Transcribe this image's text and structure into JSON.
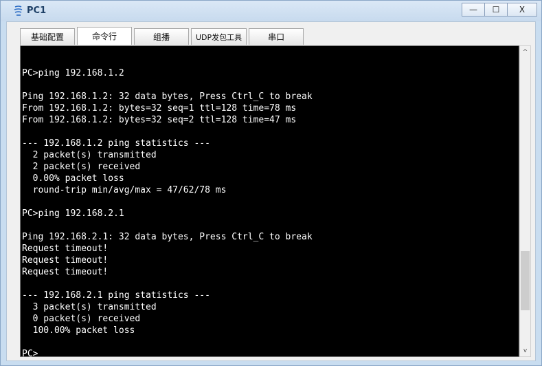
{
  "window": {
    "title": "PC1",
    "minimize_glyph": "—",
    "maximize_glyph": "☐",
    "close_glyph": "X"
  },
  "tabs": [
    {
      "label": "基础配置"
    },
    {
      "label": "命令行"
    },
    {
      "label": "组播"
    },
    {
      "label": "UDP发包工具"
    },
    {
      "label": "串口"
    }
  ],
  "active_tab": "命令行",
  "terminal": {
    "lines": [
      "",
      "PC>ping 192.168.1.2",
      "",
      "Ping 192.168.1.2: 32 data bytes, Press Ctrl_C to break",
      "From 192.168.1.2: bytes=32 seq=1 ttl=128 time=78 ms",
      "From 192.168.1.2: bytes=32 seq=2 ttl=128 time=47 ms",
      "",
      "--- 192.168.1.2 ping statistics ---",
      "  2 packet(s) transmitted",
      "  2 packet(s) received",
      "  0.00% packet loss",
      "  round-trip min/avg/max = 47/62/78 ms",
      "",
      "PC>ping 192.168.2.1",
      "",
      "Ping 192.168.2.1: 32 data bytes, Press Ctrl_C to break",
      "Request timeout!",
      "Request timeout!",
      "Request timeout!",
      "",
      "--- 192.168.2.1 ping statistics ---",
      "  3 packet(s) transmitted",
      "  0 packet(s) received",
      "  100.00% packet loss",
      "",
      "PC>"
    ]
  },
  "scrollbar": {
    "up_glyph": "^",
    "down_glyph": "v",
    "position": 0.85
  },
  "colors": {
    "terminal_bg": "#000000",
    "terminal_fg": "#ffffff",
    "titlebar": "#c9ddf0",
    "title_text": "#1d3f66"
  }
}
